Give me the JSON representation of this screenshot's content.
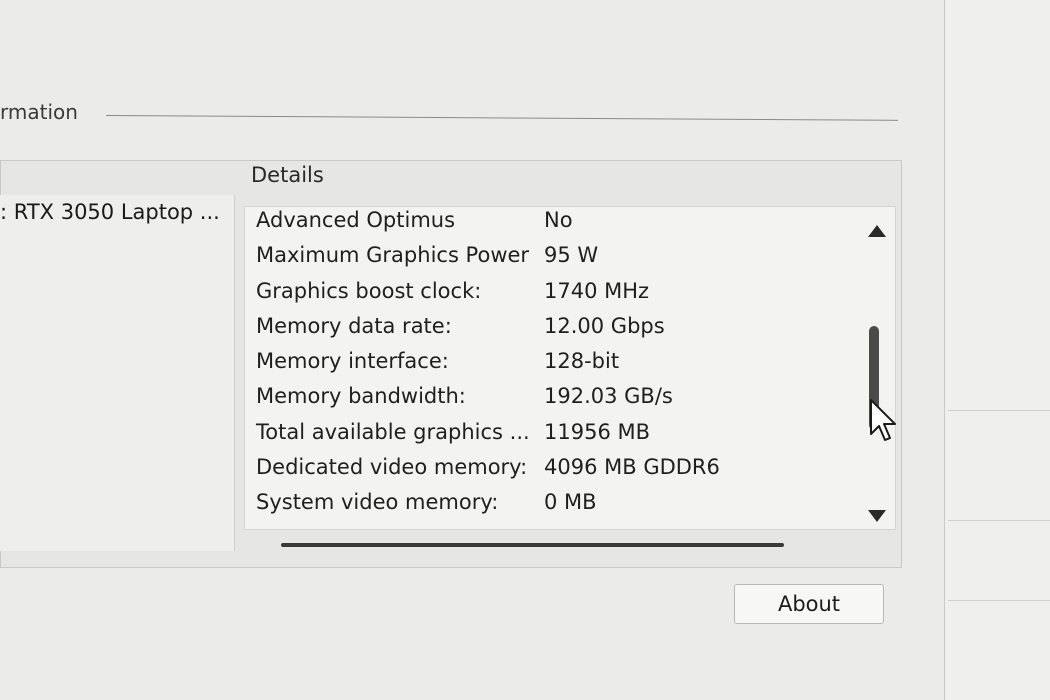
{
  "group_title": "rmation",
  "details_header": "Details",
  "left_item": ": RTX 3050 Laptop ...",
  "details": [
    {
      "key": "Advanced Optimus",
      "value": "No"
    },
    {
      "key": "Maximum Graphics Power",
      "value": "95 W"
    },
    {
      "key": "Graphics boost clock:",
      "value": "1740 MHz"
    },
    {
      "key": "Memory data rate:",
      "value": "12.00 Gbps"
    },
    {
      "key": "Memory interface:",
      "value": "128-bit"
    },
    {
      "key": "Memory bandwidth:",
      "value": "192.03 GB/s"
    },
    {
      "key": "Total available graphics ...",
      "value": "11956 MB"
    },
    {
      "key": "Dedicated video memory:",
      "value": "4096 MB GDDR6"
    },
    {
      "key": "System video memory:",
      "value": "0 MB"
    }
  ],
  "about_label": "About",
  "icons": {
    "scroll_up": "triangle-up-icon",
    "scroll_down": "triangle-down-icon",
    "cursor": "mouse-pointer-icon"
  }
}
